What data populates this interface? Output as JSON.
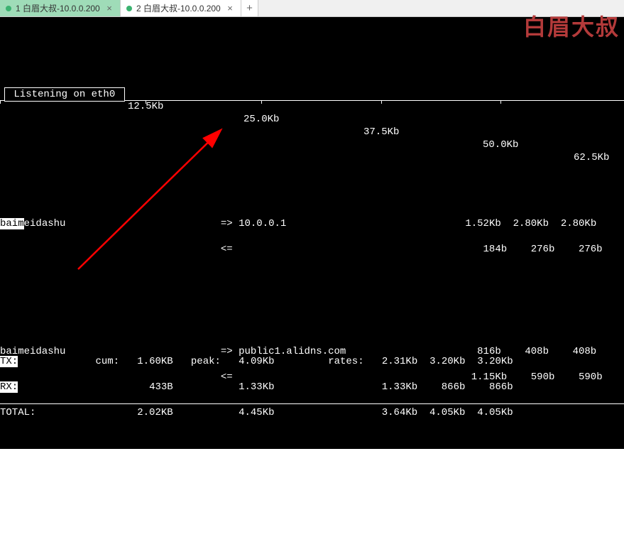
{
  "tabs": [
    {
      "label": "1 白眉大叔-10.0.0.200",
      "active": true
    },
    {
      "label": "2 白眉大叔-10.0.0.200",
      "active": false
    }
  ],
  "watermark": "白眉大叔",
  "header": {
    "listening": " Listening on eth0 ",
    "scale": [
      "12.5Kb",
      "25.0Kb",
      "37.5Kb",
      "50.0Kb",
      "62.5Kb"
    ]
  },
  "connections": [
    {
      "src": "baimeidashu",
      "src_hl_tail": "eidashu",
      "src_hl_head": "baim",
      "arrow_out": "=>",
      "arrow_in": "<=",
      "dst": "10.0.0.1",
      "out": {
        "r1": "1.52Kb",
        "r2": "2.80Kb",
        "r3": "2.80Kb"
      },
      "in": {
        "r1": "184b",
        "r2": "276b",
        "r3": "276b"
      }
    },
    {
      "src": "baimeidashu",
      "arrow_out": "=>",
      "arrow_in": "<=",
      "dst": "public1.alidns.com",
      "out": {
        "r1": "816b",
        "r2": "408b",
        "r3": "408b"
      },
      "in": {
        "r1": "1.15Kb",
        "r2": "590b",
        "r3": "590b"
      }
    }
  ],
  "footer": {
    "labels": {
      "tx": "TX:",
      "rx": "RX:",
      "total": "TOTAL:",
      "cum": "cum:",
      "peak": "peak:",
      "rates": "rates:"
    },
    "tx": {
      "cum": "1.60KB",
      "peak": "4.09Kb",
      "r1": "2.31Kb",
      "r2": "3.20Kb",
      "r3": "3.20Kb"
    },
    "rx": {
      "cum": "433B",
      "peak": "1.33Kb",
      "r1": "1.33Kb",
      "r2": "866b",
      "r3": "866b"
    },
    "total": {
      "cum": "2.02KB",
      "peak": "4.45Kb",
      "r1": "3.64Kb",
      "r2": "4.05Kb",
      "r3": "4.05Kb"
    }
  }
}
